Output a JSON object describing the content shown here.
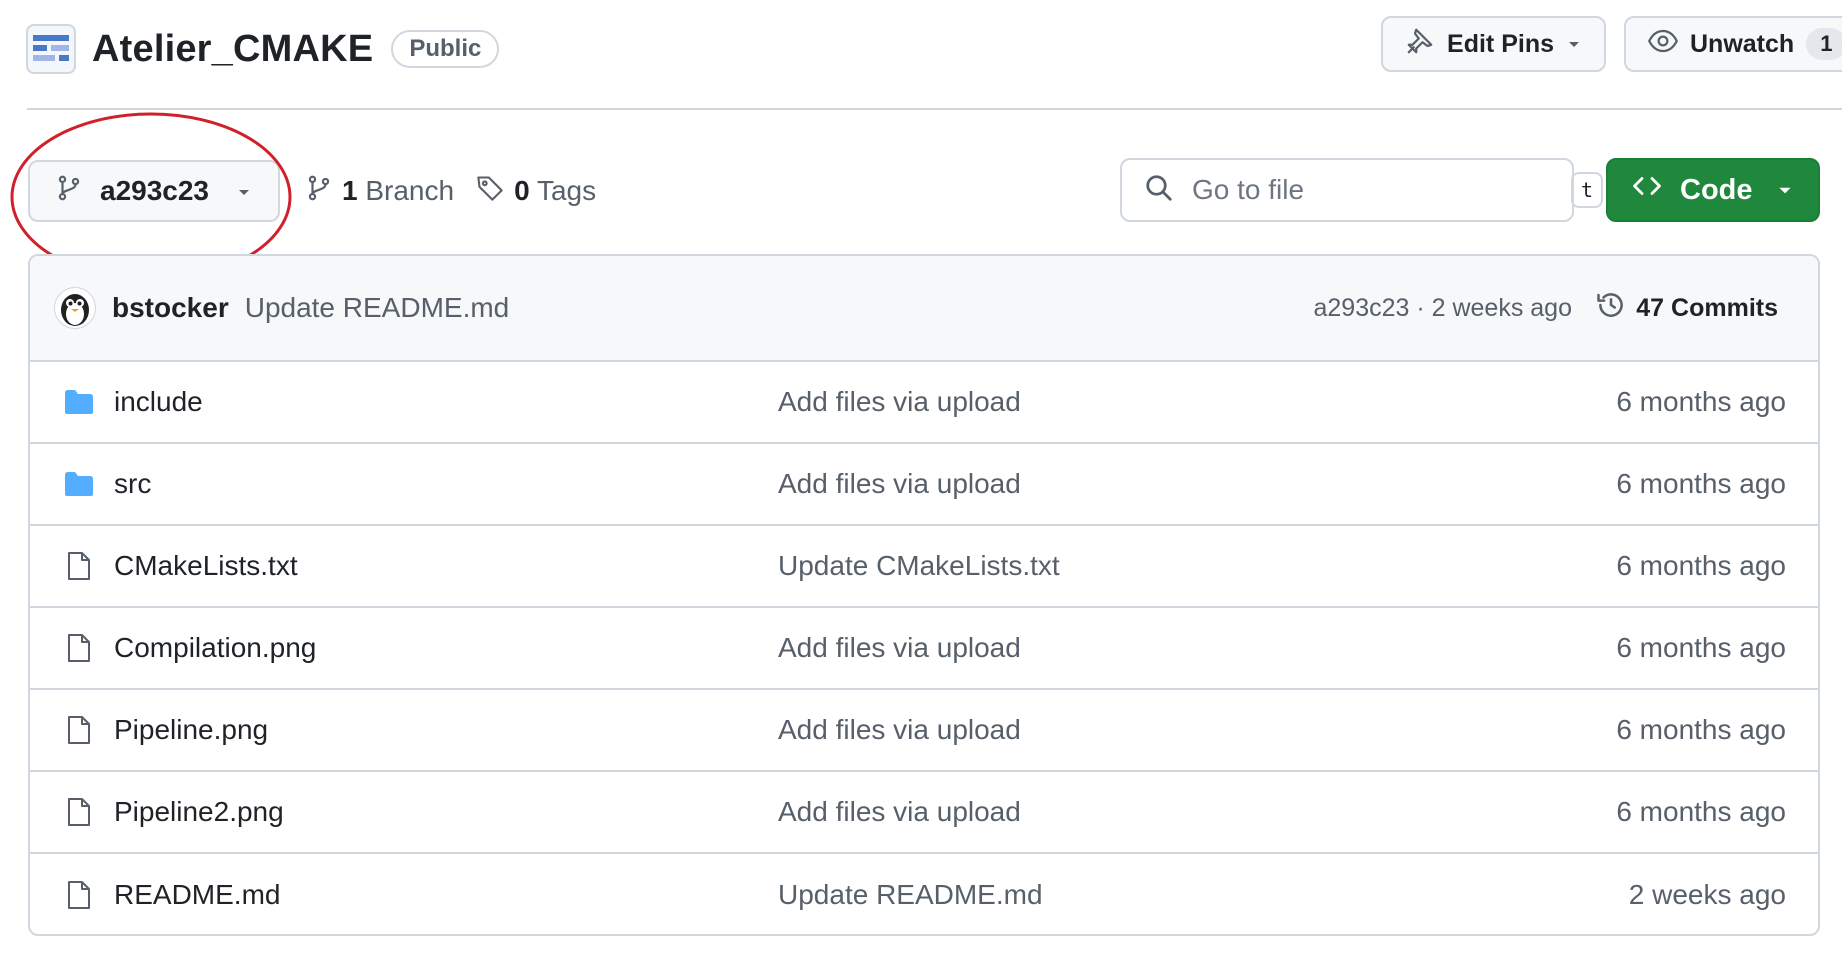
{
  "repo": {
    "name": "Atelier_CMAKE",
    "visibility": "Public",
    "avatar_icon": "repo-avatar-icon"
  },
  "header_actions": {
    "edit_pins_label": "Edit Pins",
    "unwatch_label": "Unwatch",
    "watch_count": "1"
  },
  "toolbar": {
    "branch_name": "a293c23",
    "branch_count": "1",
    "branch_label": "Branch",
    "tag_count": "0",
    "tag_label": "Tags",
    "search_placeholder": "Go to file",
    "search_shortcut": "t",
    "code_label": "Code"
  },
  "latest_commit": {
    "author": "bstocker",
    "message": "Update README.md",
    "meta": "a293c23 · 2 weeks ago",
    "commits_count_label": "47 Commits"
  },
  "files": [
    {
      "type": "folder",
      "name": "include",
      "commit": "Add files via upload",
      "age": "6 months ago"
    },
    {
      "type": "folder",
      "name": "src",
      "commit": "Add files via upload",
      "age": "6 months ago"
    },
    {
      "type": "file",
      "name": "CMakeLists.txt",
      "commit": "Update CMakeLists.txt",
      "age": "6 months ago"
    },
    {
      "type": "file",
      "name": "Compilation.png",
      "commit": "Add files via upload",
      "age": "6 months ago"
    },
    {
      "type": "file",
      "name": "Pipeline.png",
      "commit": "Add files via upload",
      "age": "6 months ago"
    },
    {
      "type": "file",
      "name": "Pipeline2.png",
      "commit": "Add files via upload",
      "age": "6 months ago"
    },
    {
      "type": "file",
      "name": "README.md",
      "commit": "Update README.md",
      "age": "2 weeks ago"
    }
  ],
  "colors": {
    "accent_green": "#1f883d",
    "folder_blue": "#54aeff",
    "annotation_red": "#d0202a",
    "border": "#d0d7de",
    "muted_text": "#57606a"
  }
}
